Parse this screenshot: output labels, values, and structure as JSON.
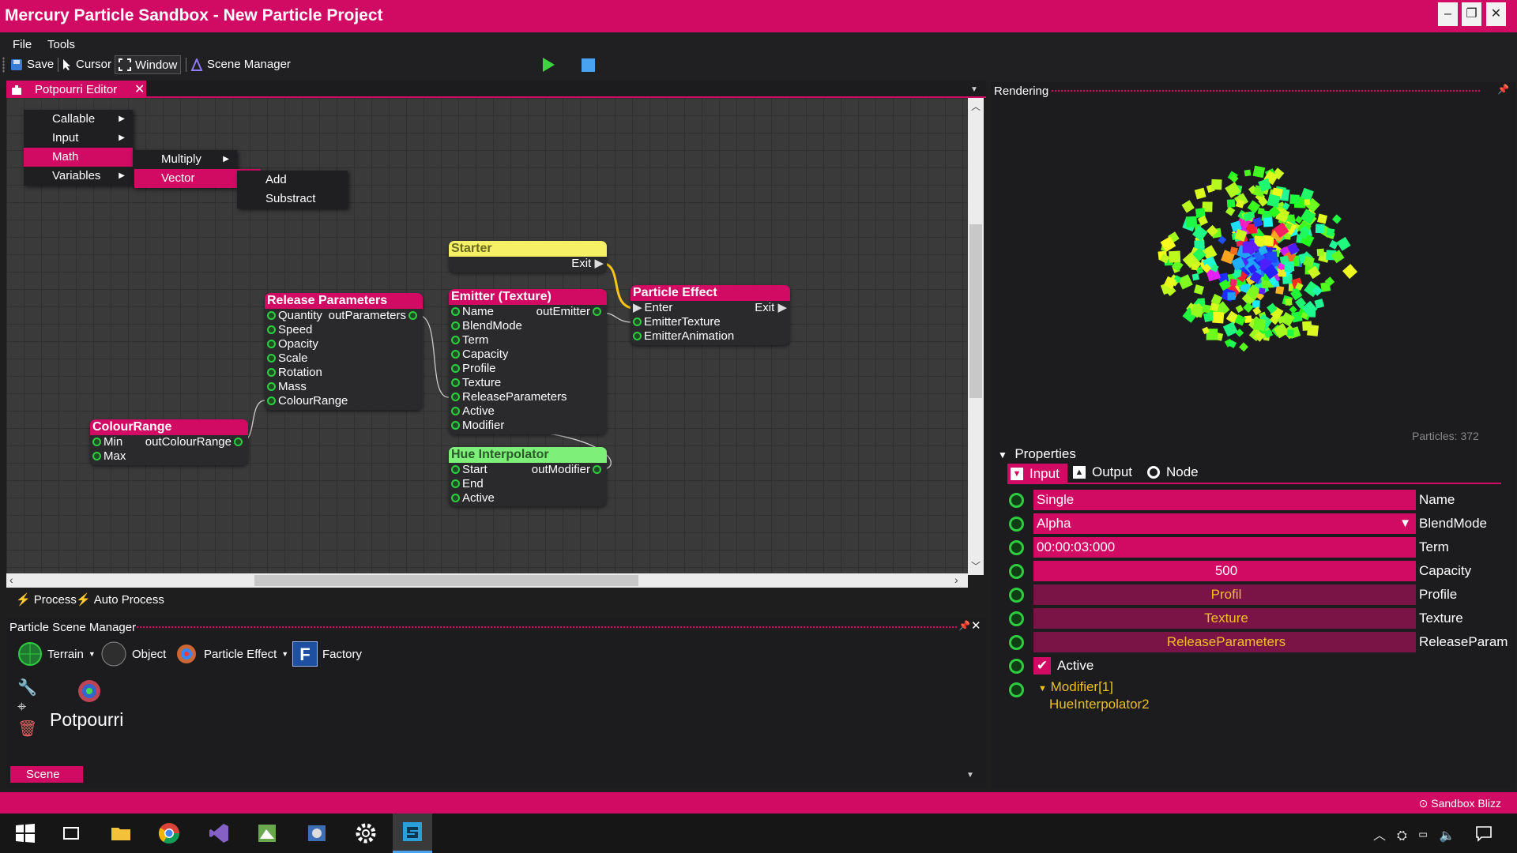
{
  "window": {
    "title": "Mercury Particle Sandbox - New Particle Project"
  },
  "menu": {
    "file": "File",
    "tools": "Tools"
  },
  "toolbar": {
    "save": "Save",
    "cursor": "Cursor",
    "window": "Window",
    "scene_manager": "Scene Manager"
  },
  "editor": {
    "tab": "Potpourri Editor",
    "context_menu": {
      "items": [
        "Callable",
        "Input",
        "Math",
        "Variables"
      ],
      "math_sub": [
        "Multiply",
        "Vector"
      ],
      "vector_sub": [
        "Add",
        "Substract"
      ]
    },
    "nodes": {
      "starter": {
        "title": "Starter",
        "out": "Exit"
      },
      "particle_effect": {
        "title": "Particle Effect",
        "inputs": [
          "Enter",
          "EmitterTexture",
          "EmitterAnimation"
        ],
        "out": "Exit"
      },
      "emitter": {
        "title": "Emitter (Texture)",
        "inputs": [
          "Name",
          "BlendMode",
          "Term",
          "Capacity",
          "Profile",
          "Texture",
          "ReleaseParameters",
          "Active",
          "Modifier"
        ],
        "out": "outEmitter"
      },
      "release": {
        "title": "Release Parameters",
        "inputs": [
          "Quantity",
          "Speed",
          "Opacity",
          "Scale",
          "Rotation",
          "Mass",
          "ColourRange"
        ],
        "out": "outParameters"
      },
      "colour": {
        "title": "ColourRange",
        "inputs": [
          "Min",
          "Max"
        ],
        "out": "outColourRange"
      },
      "hue": {
        "title": "Hue Interpolator",
        "inputs": [
          "Start",
          "End",
          "Active"
        ],
        "out": "outModifier"
      }
    },
    "process": "Process",
    "auto_process": "Auto Process"
  },
  "scene_manager": {
    "title": "Particle Scene Manager",
    "tools": {
      "terrain": "Terrain",
      "object": "Object",
      "particle_effect": "Particle Effect",
      "factory": "Factory"
    },
    "item": "Potpourri",
    "tab": "Scene"
  },
  "rendering": {
    "title": "Rendering",
    "particles": "Particles: 372"
  },
  "properties": {
    "title": "Properties",
    "tabs": {
      "input": "Input",
      "output": "Output",
      "node": "Node"
    },
    "rows": [
      {
        "value": "Single",
        "label": "Name"
      },
      {
        "value": "Alpha",
        "label": "BlendMode"
      },
      {
        "value": "00:00:03:000",
        "label": "Term"
      },
      {
        "value": "500",
        "label": "Capacity"
      },
      {
        "value": "Profil",
        "label": "Profile"
      },
      {
        "value": "Texture",
        "label": "Texture"
      },
      {
        "value": "ReleaseParameters",
        "label": "ReleaseParam"
      }
    ],
    "active": "Active",
    "modifier": "Modifier[1]",
    "modifier_child": "HueInterpolator2"
  },
  "statusbar": {
    "text": "⊙ Sandbox Blizz"
  },
  "colors": {
    "accent": "#d10a64",
    "pin": "#2ecc40",
    "starter": "#f5f066",
    "hue": "#7ef07a",
    "gold": "#f0c020"
  },
  "taskbar": {
    "icons": [
      "windows-start-icon",
      "task-view-icon",
      "file-explorer-icon",
      "chrome-icon",
      "visual-studio-icon",
      "image-editor-icon",
      "app-icon",
      "settings-icon",
      "sandbox-app-icon"
    ]
  }
}
